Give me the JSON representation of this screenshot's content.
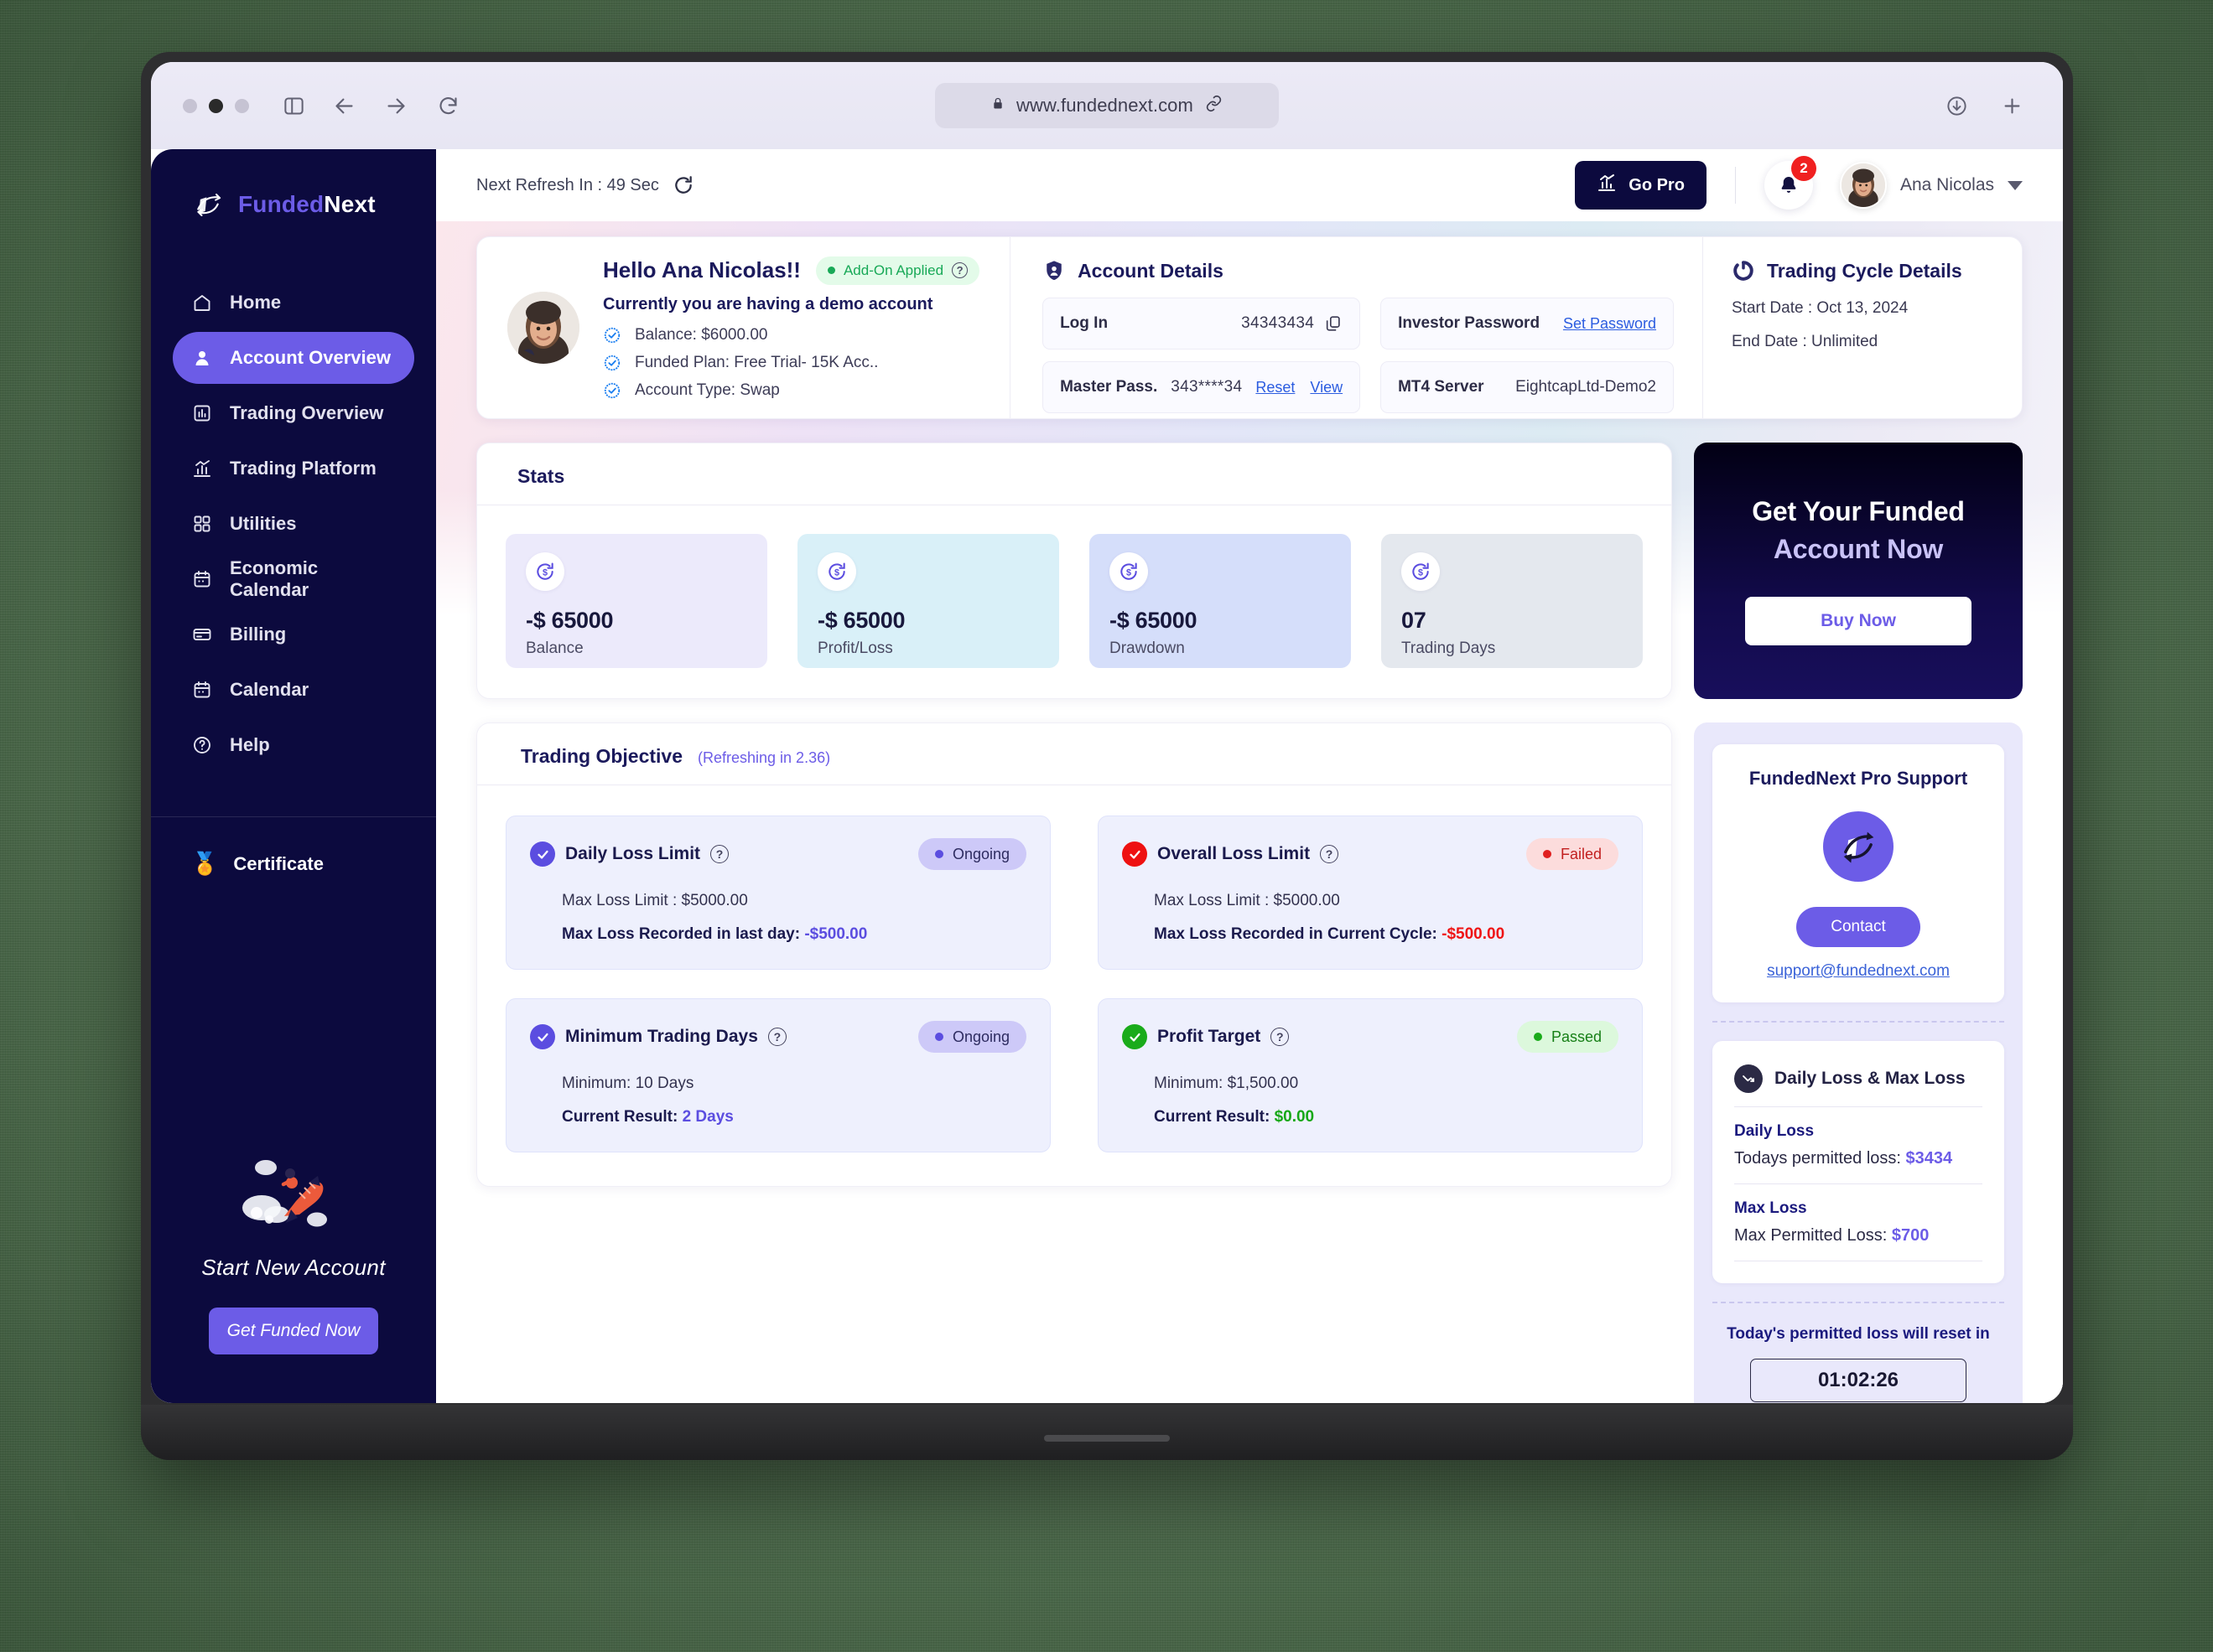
{
  "browser": {
    "url": "www.fundednext.com",
    "icons": [
      "lock-icon",
      "link-icon",
      "sidebar-toggle-icon",
      "back-arrow-icon",
      "forward-arrow-icon",
      "reload-icon",
      "download-icon",
      "new-tab-icon"
    ]
  },
  "sidebar": {
    "brand": {
      "first": "Funded",
      "second": "Next"
    },
    "items": [
      {
        "label": "Home",
        "icon": "home-icon",
        "active": false
      },
      {
        "label": "Account Overview",
        "icon": "user-icon",
        "active": true
      },
      {
        "label": "Trading Overview",
        "icon": "bar-chart-icon",
        "active": false
      },
      {
        "label": "Trading Platform",
        "icon": "chart-line-icon",
        "active": false
      },
      {
        "label": "Utilities",
        "icon": "grid-icon",
        "active": false
      },
      {
        "label": "Economic Calendar",
        "icon": "calendar-icon",
        "active": false
      },
      {
        "label": "Billing",
        "icon": "card-icon",
        "active": false
      },
      {
        "label": "Calendar",
        "icon": "calendar-icon",
        "active": false
      },
      {
        "label": "Help",
        "icon": "help-circle-icon",
        "active": false
      }
    ],
    "certificate": {
      "label": "Certificate",
      "icon": "medal-icon"
    },
    "promo": {
      "title": "Start New Account",
      "button": "Get Funded Now",
      "illustration": "rocket-illustration"
    }
  },
  "topbar": {
    "refresh_text": "Next Refresh In : 49 Sec",
    "refresh_icon": "refresh-icon",
    "go_pro": "Go Pro",
    "go_pro_icon": "chart-up-icon",
    "notification_count": "2",
    "notification_icon": "bell-icon",
    "user_name": "Ana Nicolas",
    "avatar": "user-avatar"
  },
  "profile": {
    "greeting": "Hello Ana Nicolas!!",
    "addon_badge": "Add-On Applied",
    "demo_line": "Currently you are having a demo account",
    "facts": [
      "Balance: $6000.00",
      "Funded Plan: Free Trial- 15K Acc..",
      "Account Type: Swap"
    ]
  },
  "account_details": {
    "title": "Account Details",
    "icon": "shield-user-icon",
    "login_label": "Log In",
    "login_value": "34343434",
    "investor_password_label": "Investor Password",
    "investor_password_action": "Set Password",
    "master_pass_label": "Master Pass.",
    "master_pass_value": "343****34",
    "master_pass_reset": "Reset",
    "master_pass_view": "View",
    "mt4_label": "MT4 Server",
    "mt4_value": "EightcapLtd-Demo2"
  },
  "trading_cycle": {
    "title": "Trading Cycle Details",
    "icon": "cycle-icon",
    "start_date": "Start Date : Oct 13, 2024",
    "end_date": "End Date : Unlimited"
  },
  "stats": {
    "title": "Stats",
    "icon": "stats-icon",
    "cards": [
      {
        "value": "-$ 65000",
        "label": "Balance",
        "bg": "#eceafb",
        "icon": "dollar-refresh-icon"
      },
      {
        "value": "-$ 65000",
        "label": "Profit/Loss",
        "bg": "#d9f0f8",
        "icon": "dollar-refresh-icon"
      },
      {
        "value": "-$ 65000",
        "label": "Drawdown",
        "bg": "#d5defa",
        "icon": "dollar-refresh-icon"
      },
      {
        "value": "07",
        "label": "Trading Days",
        "bg": "#e4e8ee",
        "icon": "dollar-refresh-icon"
      }
    ]
  },
  "buy_banner": {
    "line1": "Get Your Funded",
    "line2": "Account Now",
    "button": "Buy Now"
  },
  "objective": {
    "title": "Trading Objective",
    "icon": "objective-icon",
    "refreshing": "(Refreshing in 2.36)",
    "items": [
      {
        "name": "Daily Loss Limit",
        "status": "Ongoing",
        "status_kind": "ongoing",
        "badge_color": "#5b4de0",
        "line1": "Max Loss Limit : $5000.00",
        "line2_label": "Max Loss Recorded in last day:",
        "line2_value": "-$500.00",
        "value_kind": "purple"
      },
      {
        "name": "Overall Loss Limit",
        "status": "Failed",
        "status_kind": "failed",
        "badge_color": "#ee1111",
        "line1": "Max Loss Limit : $5000.00",
        "line2_label": "Max Loss Recorded in Current Cycle:",
        "line2_value": "-$500.00",
        "value_kind": "red"
      },
      {
        "name": "Minimum Trading Days",
        "status": "Ongoing",
        "status_kind": "ongoing",
        "badge_color": "#5b4de0",
        "line1": "Minimum: 10 Days",
        "line2_label": "Current Result:",
        "line2_value": "2 Days",
        "value_kind": "purple"
      },
      {
        "name": "Profit Target",
        "status": "Passed",
        "status_kind": "passed",
        "badge_color": "#1aab1a",
        "line1": "Minimum: $1,500.00",
        "line2_label": "Current Result:",
        "line2_value": "$0.00",
        "value_kind": "green"
      }
    ]
  },
  "support": {
    "title": "FundedNext Pro Support",
    "logo": "fundednext-logo-icon",
    "button": "Contact",
    "email": "support@fundednext.com"
  },
  "loss_panel": {
    "title": "Daily Loss & Max Loss",
    "icon": "trend-down-icon",
    "daily_loss_heading": "Daily Loss",
    "daily_loss_text": "Todays permitted loss: ",
    "daily_loss_value": "$3434",
    "max_loss_heading": "Max Loss",
    "max_loss_text": "Max Permitted Loss: ",
    "max_loss_value": "$700"
  },
  "reset": {
    "title": "Today's permitted loss will reset in",
    "timer": "01:02:26"
  },
  "colors": {
    "brand_purple": "#6c5ce7",
    "deep_navy": "#0c0a3e",
    "danger": "#ee1111",
    "success": "#1aab1a"
  }
}
